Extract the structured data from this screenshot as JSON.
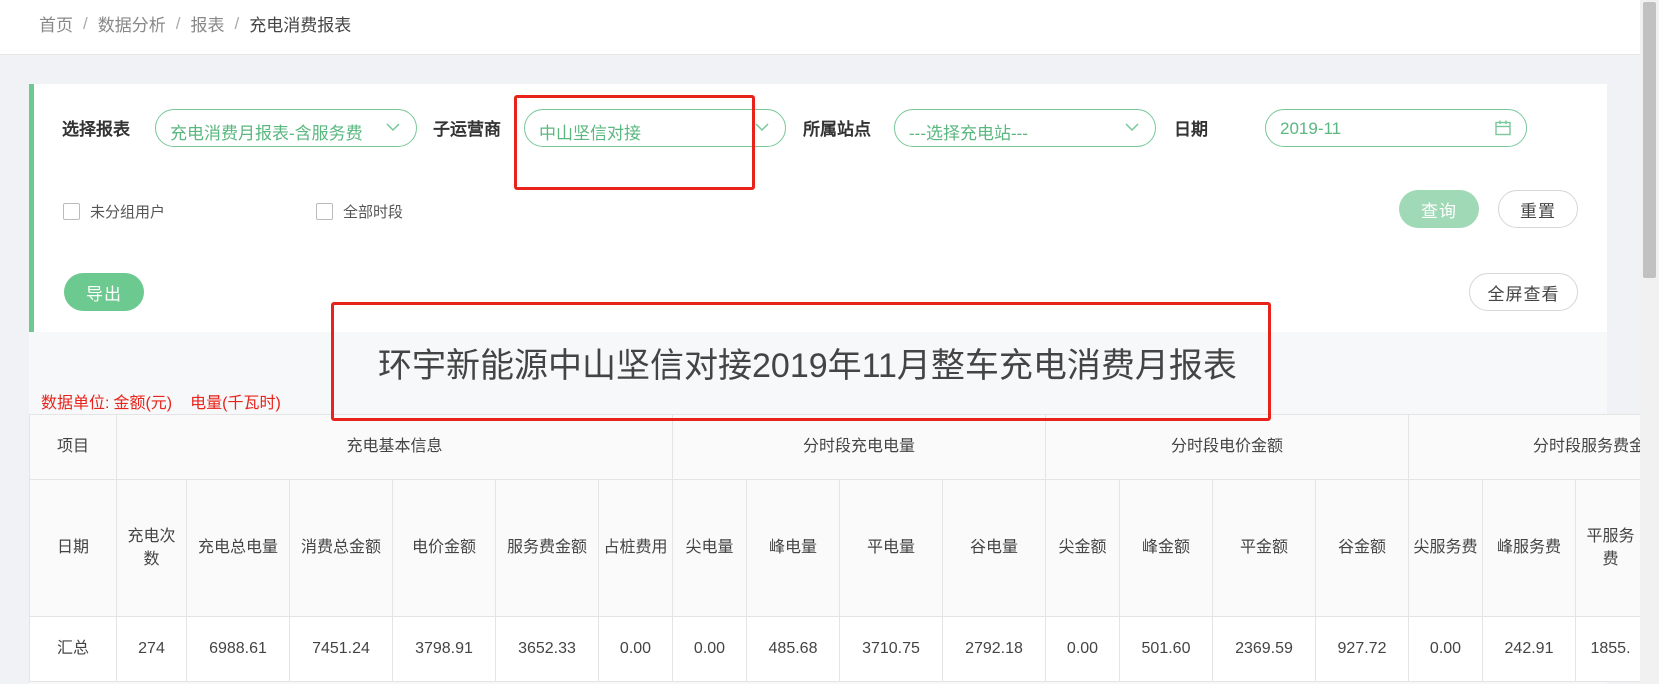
{
  "breadcrumb": [
    "首页",
    "数据分析",
    "报表",
    "充电消费报表"
  ],
  "filters": {
    "report_label": "选择报表",
    "report_value": "充电消费月报表-含服务费",
    "operator_label": "子运营商",
    "operator_value": "中山坚信对接",
    "station_label": "所属站点",
    "station_value": "---选择充电站---",
    "date_label": "日期",
    "date_value": "2019-11",
    "ungrouped_users": "未分组用户",
    "all_periods": "全部时段"
  },
  "buttons": {
    "query": "查询",
    "reset": "重置",
    "export": "导出",
    "fullscreen": "全屏查看"
  },
  "report": {
    "title": "环宇新能源中山坚信对接2019年11月整车充电消费月报表",
    "unit_prefix": "数据单位:",
    "unit_money": "金额(元)",
    "unit_energy": "电量(千瓦时)",
    "table": {
      "groups": [
        "项目",
        "充电基本信息",
        "分时段充电电量",
        "分时段电价金额",
        "分时段服务费金"
      ],
      "columns": [
        "日期",
        "充电次数",
        "充电总电量",
        "消费总金额",
        "电价金额",
        "服务费金额",
        "占桩费用",
        "尖电量",
        "峰电量",
        "平电量",
        "谷电量",
        "尖金额",
        "峰金额",
        "平金额",
        "谷金额",
        "尖服务费",
        "峰服务费",
        "平服务费"
      ],
      "rows": [
        [
          "汇总",
          "274",
          "6988.61",
          "7451.24",
          "3798.91",
          "3652.33",
          "0.00",
          "0.00",
          "485.68",
          "3710.75",
          "2792.18",
          "0.00",
          "501.60",
          "2369.59",
          "927.72",
          "0.00",
          "242.91",
          "1855."
        ]
      ]
    }
  },
  "colors": {
    "accent_green": "#6cc98f",
    "annotation_red": "#e8231b"
  }
}
